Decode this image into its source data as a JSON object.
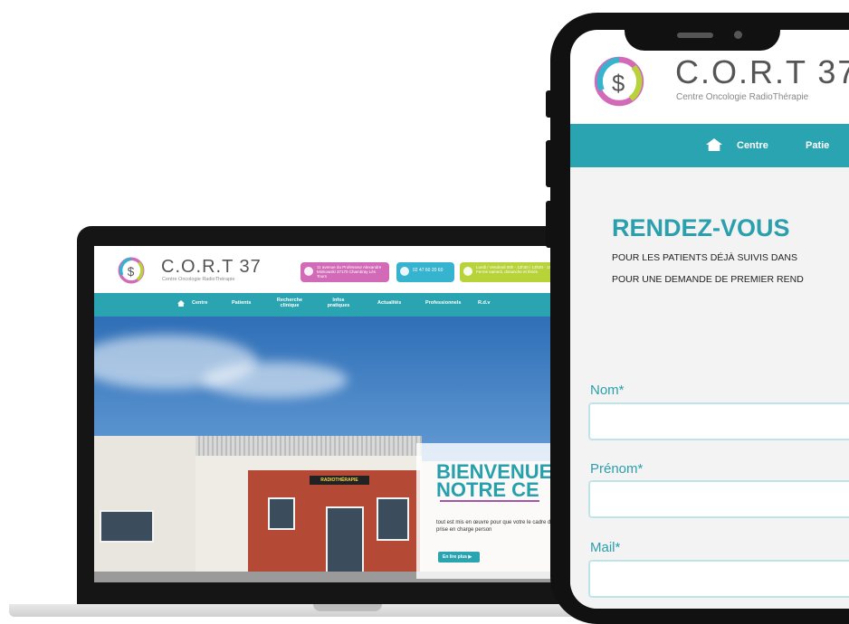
{
  "brand": {
    "name": "C.O.R.T 37",
    "tagline": "Centre Oncologie RadioThérapie"
  },
  "laptop": {
    "info_cards": {
      "address": "11 avenue du Professeur Alexandre Minkowski 37170 Chambray Lès Tours",
      "phone": "02 47 60 20 60",
      "hours": "Lundi / Vendredi 08h - 12h30 / 13h30 - 18h00 Fermé samedi, dimanche et fériés"
    },
    "nav": [
      "Centre",
      "Patients",
      "Recherche clinique",
      "Infos pratiques",
      "Actualités",
      "Professionnels",
      "R.d.v"
    ],
    "hero": {
      "welcome": "BIENVENUE\nNOTRE CE",
      "intro": "tout est mis en œuvre pour que votre le cadre d’une prise en charge person",
      "button": "En lire plus",
      "sign": "RADIOTHÉRAPIE"
    }
  },
  "phone": {
    "nav": [
      "Centre",
      "Patie"
    ],
    "page_title": "RENDEZ-VOUS",
    "lines": [
      "POUR LES PATIENTS DÉJÀ SUIVIS DANS",
      "POUR UNE DEMANDE DE PREMIER REND"
    ],
    "form": [
      {
        "label": "Nom*",
        "value": ""
      },
      {
        "label": "Prénom*",
        "value": ""
      },
      {
        "label": "Mail*",
        "value": ""
      }
    ]
  },
  "colors": {
    "teal": "#2aa4b0",
    "pink": "#d36ab8",
    "blue": "#36b3cf",
    "lime": "#b8d23a"
  }
}
